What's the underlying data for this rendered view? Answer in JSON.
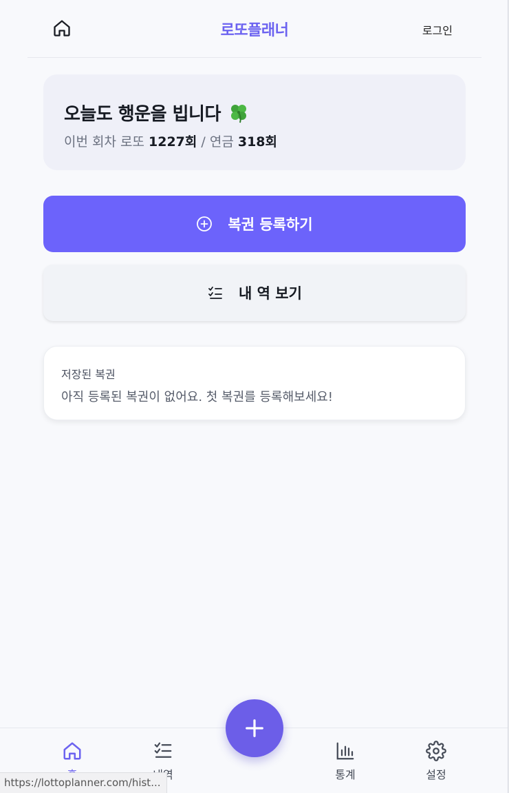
{
  "header": {
    "brand": "로또플래너",
    "login_label": "로그인"
  },
  "greeting": {
    "title": "오늘도 행운을 빕니다",
    "emoji_icon": "four-leaf-clover-icon",
    "subtitle_prefix": "이번 회차 로또 ",
    "lotto_round": "1227회",
    "separator": " / 연금 ",
    "pension_round": "318회"
  },
  "actions": {
    "register_label": "복권 등록하기",
    "history_label": "내 역 보기"
  },
  "saved": {
    "title": "저장된 복권",
    "empty_message": "아직 등록된 복권이 없어요. 첫 복권를 등록해보세요!"
  },
  "bottom_nav": {
    "items": [
      {
        "label": "홈",
        "icon": "home-icon",
        "active": true
      },
      {
        "label": "내역",
        "icon": "list-check-icon",
        "active": false
      },
      {
        "label": "통계",
        "icon": "bar-chart-icon",
        "active": false
      },
      {
        "label": "설정",
        "icon": "gear-icon",
        "active": false
      }
    ],
    "fab_icon": "plus-icon"
  },
  "status_bar": {
    "url": "https://lottoplanner.com/hist..."
  },
  "colors": {
    "accent": "#6c63fb",
    "background": "#f8f9fc",
    "text": "#161a22"
  }
}
